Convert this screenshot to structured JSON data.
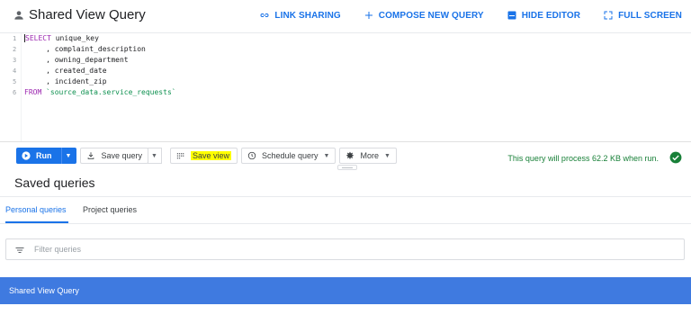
{
  "header": {
    "title": "Shared View Query",
    "actions": [
      {
        "label": "LINK SHARING",
        "icon": "link-icon"
      },
      {
        "label": "COMPOSE NEW QUERY",
        "icon": "plus-icon"
      },
      {
        "label": "HIDE EDITOR",
        "icon": "hide-editor-icon"
      },
      {
        "label": "FULL SCREEN",
        "icon": "fullscreen-icon"
      }
    ]
  },
  "editor": {
    "lines": [
      {
        "num": "1",
        "kw": "SELECT",
        "text": " unique_key"
      },
      {
        "num": "2",
        "kw": "",
        "text": "     , complaint_description"
      },
      {
        "num": "3",
        "kw": "",
        "text": "     , owning_department"
      },
      {
        "num": "4",
        "kw": "",
        "text": "     , created_date"
      },
      {
        "num": "5",
        "kw": "",
        "text": "     , incident_zip"
      },
      {
        "num": "6",
        "kw": "FROM",
        "text": " `source_data.service_requests`"
      }
    ]
  },
  "toolbar": {
    "run_label": "Run",
    "save_query_label": "Save query",
    "save_view_label": "Save view",
    "schedule_query_label": "Schedule query",
    "more_label": "More",
    "status_text": "This query will process 62.2 KB when run.",
    "status_color": "#188038",
    "accent": "#1a73e8"
  },
  "saved_queries": {
    "title": "Saved queries",
    "tabs": [
      {
        "label": "Personal queries",
        "active": true
      },
      {
        "label": "Project queries",
        "active": false
      }
    ],
    "filter_placeholder": "Filter queries",
    "rows": [
      {
        "name": "Shared View Query",
        "selected": true
      }
    ],
    "selected_color": "#3f7ae0"
  }
}
